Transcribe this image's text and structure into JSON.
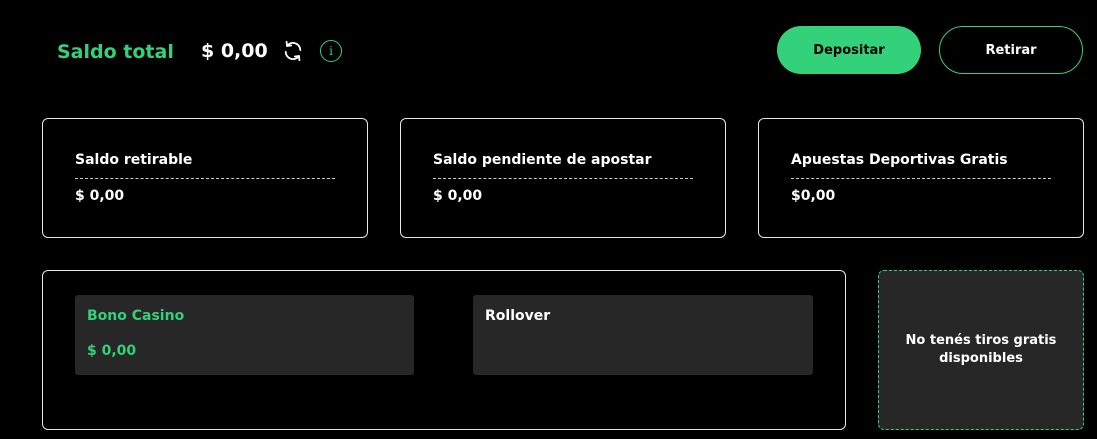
{
  "header": {
    "title": "Saldo total",
    "amount": "$ 0,00",
    "refresh_icon": "refresh-icon",
    "info_icon": "info-icon",
    "info_glyph": "i",
    "deposit_label": "Depositar",
    "withdraw_label": "Retirar"
  },
  "cards": [
    {
      "label": "Saldo retirable",
      "value": "$ 0,00"
    },
    {
      "label": "Saldo pendiente de apostar",
      "value": "$ 0,00"
    },
    {
      "label": "Apuestas Deportivas Gratis",
      "value": "$0,00"
    }
  ],
  "bonus": {
    "casino_label": "Bono Casino",
    "casino_value": "$ 0,00",
    "rollover_label": "Rollover"
  },
  "free_spins": {
    "message": "No tenés tiros gratis disponibles"
  },
  "colors": {
    "accent": "#33d17a",
    "background": "#000000",
    "tile": "#272727"
  }
}
